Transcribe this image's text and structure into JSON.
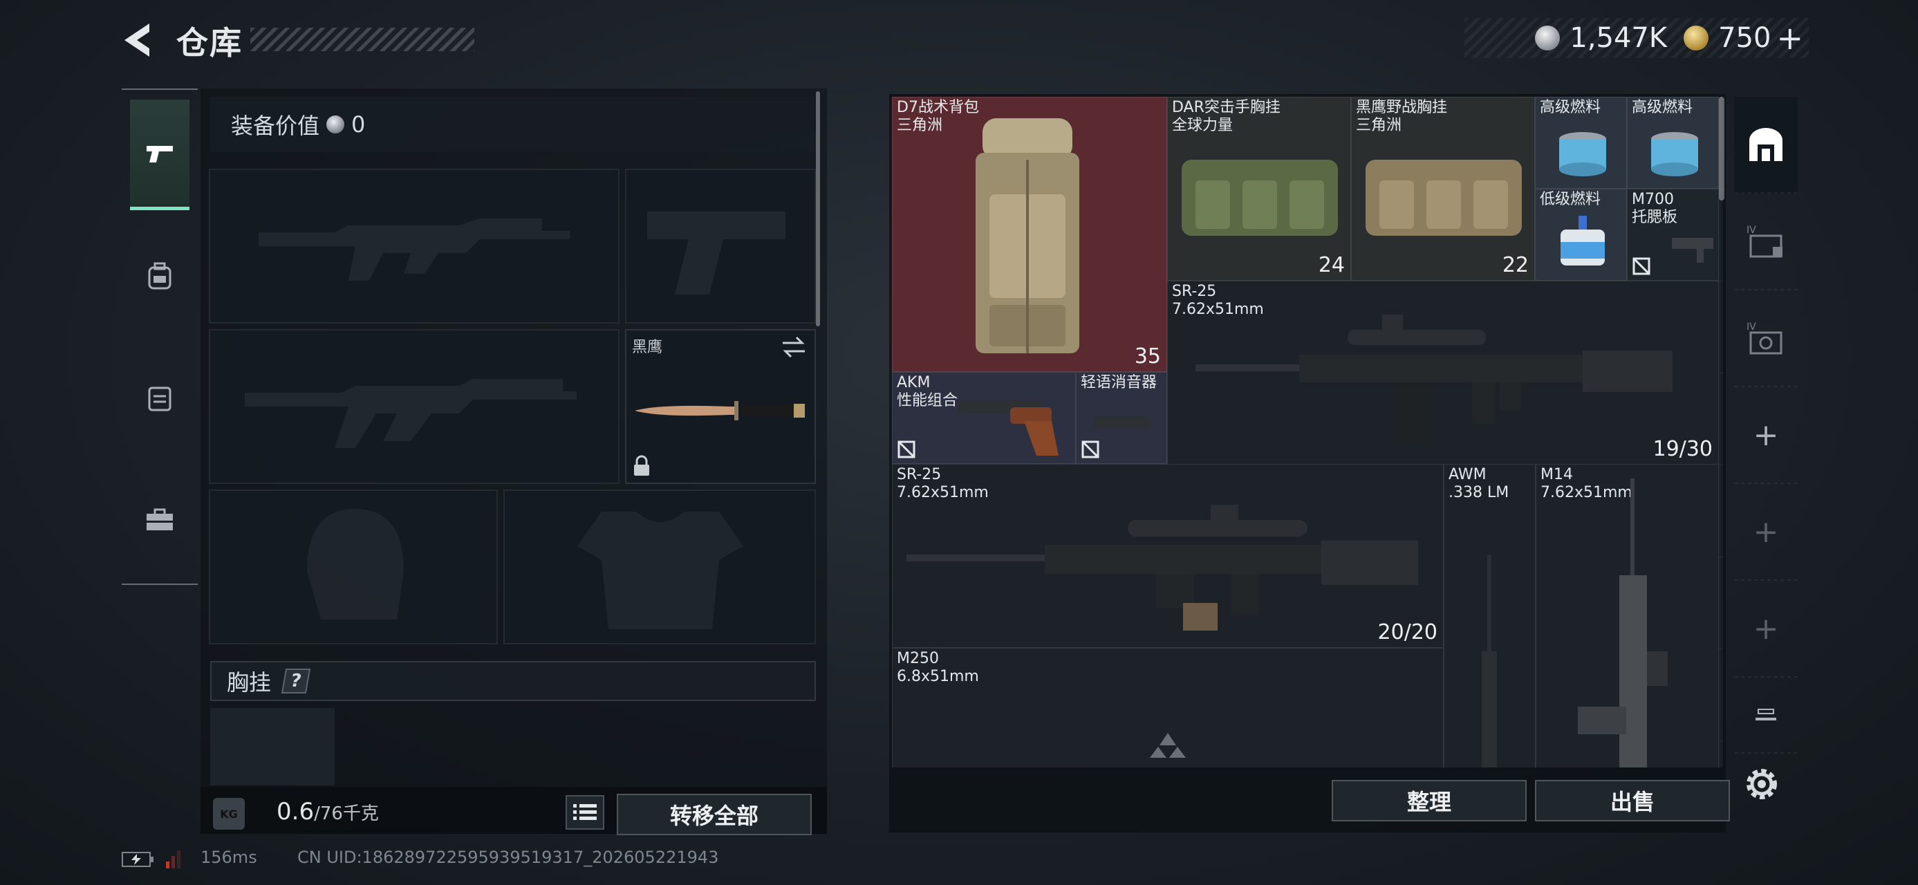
{
  "header": {
    "title": "仓库",
    "currency_silver": "1,547K",
    "currency_gold": "750",
    "currency_plus": "+"
  },
  "left_nav": {
    "items": [
      {
        "name": "weapons",
        "icon": "pistol-icon",
        "active": true
      },
      {
        "name": "armor",
        "icon": "backpack-icon",
        "active": false
      },
      {
        "name": "bags",
        "icon": "bag-icon",
        "active": false
      },
      {
        "name": "medkit",
        "icon": "toolbox-icon",
        "active": false
      }
    ]
  },
  "loadout": {
    "equip_value_label": "装备价值",
    "equip_value": "0",
    "knife_label": "黑鹰",
    "chest_rig_label": "胸挂",
    "help": "?",
    "weight_current": "0.6",
    "weight_max": "/76千克",
    "kg_badge": "KG",
    "transfer_all": "转移全部"
  },
  "stash": {
    "items": [
      {
        "name": "D7战术背包",
        "sub": "三角洲",
        "count": "35"
      },
      {
        "name": "DAR突击手胸挂",
        "sub": "全球力量",
        "count": "24"
      },
      {
        "name": "黑鹰野战胸挂",
        "sub": "三角洲",
        "count": "22"
      },
      {
        "name": "高级燃料",
        "sub": ""
      },
      {
        "name": "高级燃料",
        "sub": ""
      },
      {
        "name": "低级燃料",
        "sub": ""
      },
      {
        "name": "M700",
        "sub": "托腮板"
      },
      {
        "name": "SR-25",
        "sub": "7.62x51mm",
        "count": "19/30"
      },
      {
        "name": "AKM",
        "sub": "性能组合"
      },
      {
        "name": "轻语消音器",
        "sub": ""
      },
      {
        "name": "SR-25",
        "sub": "7.62x51mm",
        "count": "20/20"
      },
      {
        "name": "AWM",
        "sub": ".338 LM"
      },
      {
        "name": "M14",
        "sub": "7.62x51mm"
      },
      {
        "name": "M250",
        "sub": "6.8x51mm"
      }
    ],
    "organize": "整理",
    "sell": "出售"
  },
  "right_tabs": {
    "tabs": [
      {
        "icon": "stash-home-icon",
        "active": true
      },
      {
        "icon": "container-iv-icon"
      },
      {
        "icon": "container-iv-2-icon"
      },
      {
        "icon": "plus-icon"
      },
      {
        "icon": "plus-dim-icon"
      },
      {
        "icon": "plus-dim-icon"
      },
      {
        "icon": "tray-icon"
      }
    ],
    "plus": "+"
  },
  "status": {
    "ping": "156ms",
    "uid": "CN UID:18628972259593951931​7_202605221943"
  },
  "colors": {
    "accent": "#7fe6c4",
    "backpack_bg": "#5a2a30",
    "chest_bg": "#2a2e2f",
    "fuel_bg": "#2c3440"
  }
}
